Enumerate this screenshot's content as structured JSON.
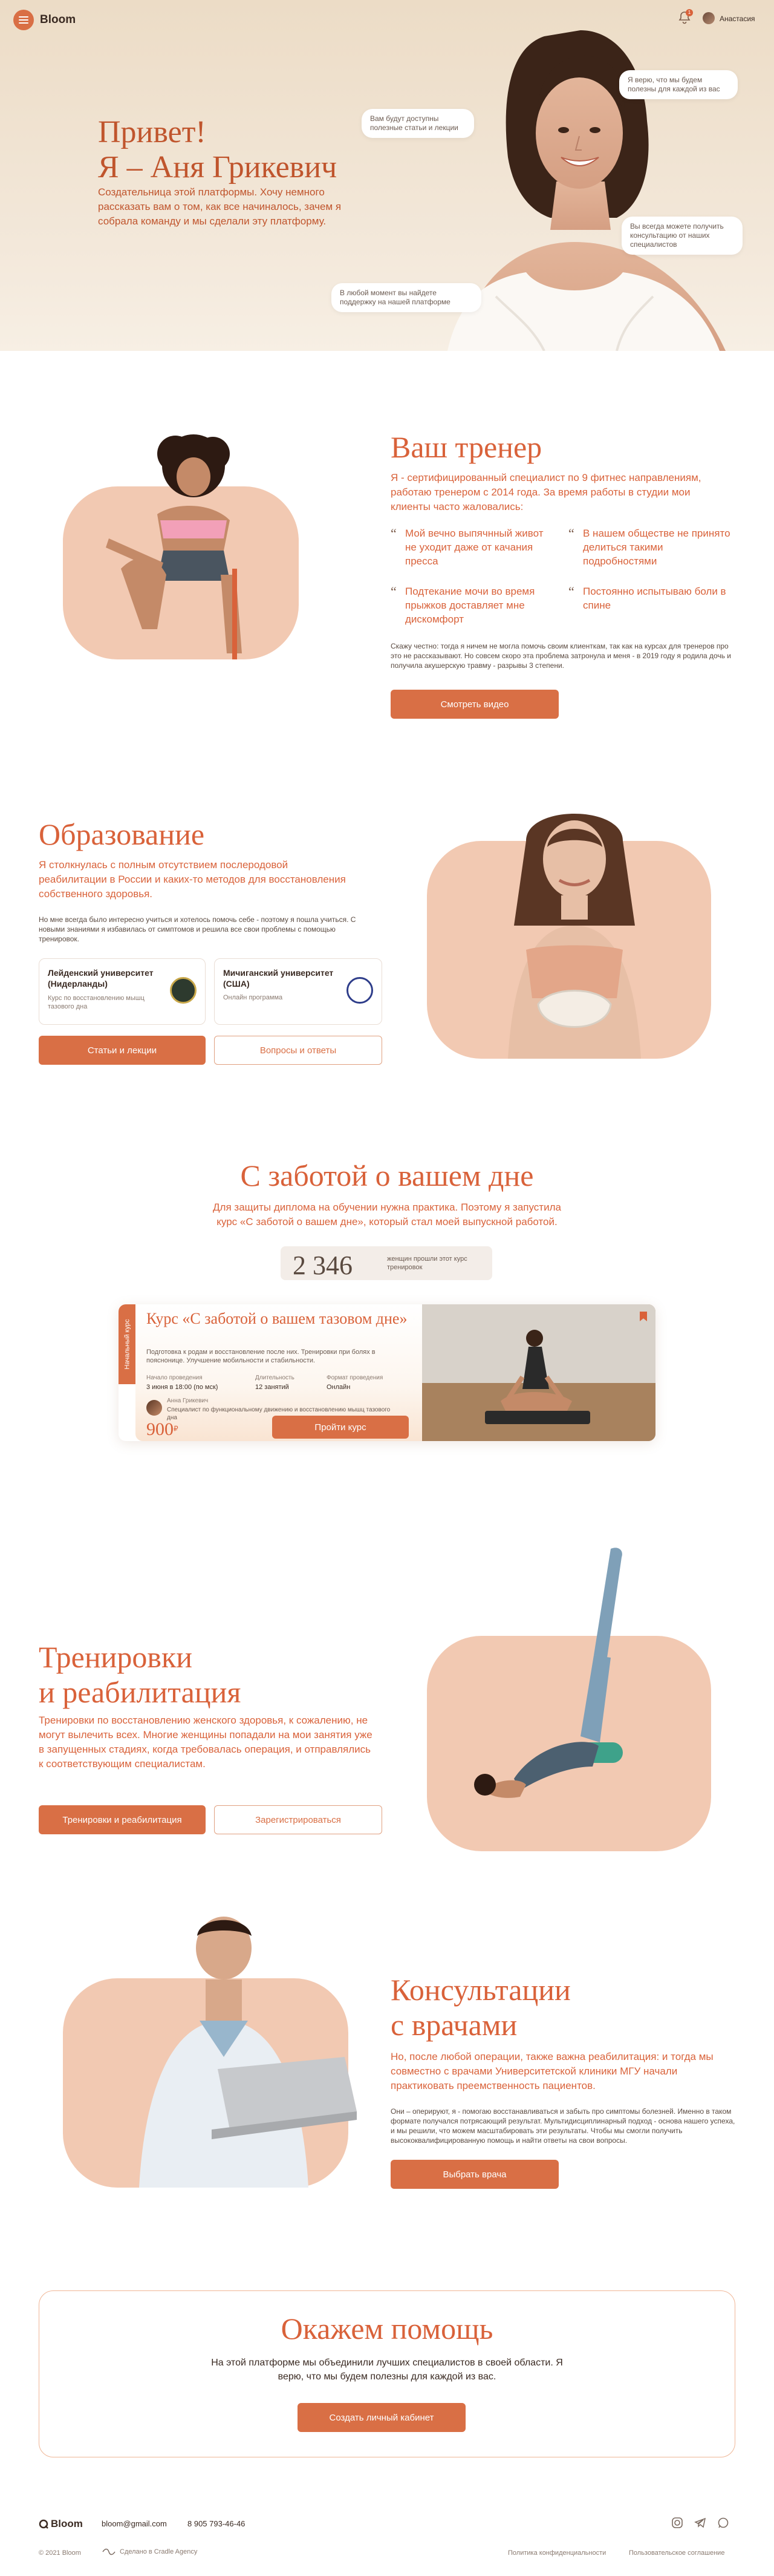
{
  "header": {
    "brand": "Bloom",
    "user_name": "Анастасия",
    "notification_count": "1"
  },
  "hero": {
    "title_line1": "Привет!",
    "title_line2": "Я – Аня Грикевич",
    "subtitle": "Создательница этой платформы. Хочу немного рассказать вам о том, как все начиналось, зачем я собрала команду и мы сделали эту платформу.",
    "bubbles": [
      "Вам будут доступны полезные статьи и лекции",
      "Я верю, что мы будем полезны для каждой из вас",
      "Вы всегда можете получить консультацию от наших специалистов",
      "В любой момент вы найдете поддержку на нашей платформе"
    ]
  },
  "trainer": {
    "title": "Ваш тренер",
    "intro": "Я - сертифицированный специалист по 9 фитнес направлениям, работаю тренером с 2014 года. За время работы в студии мои клиенты часто жаловались:",
    "quotes": [
      "Мой вечно выпячнный живот не уходит даже от качания пресса",
      "В нашем обществе не принято делиться такими подробностями",
      "Подтекание мочи во время прыжков доставляет мне дискомфорт",
      "Постоянно испытываю боли в спине"
    ],
    "note": "Скажу честно: тогда я ничем не могла помочь своим клиенткам, так как на курсах для тренеров про это не рассказывают. Но совсем скоро эта проблема затронула и меня - в 2019 году я родила дочь и получила акушерскую травму - разрывы 3 степени.",
    "button": "Смотреть видео"
  },
  "education": {
    "title": "Образование",
    "intro": "Я столкнулась с полным отсутствием послеродовой реабилитации в России и каких-то методов для восстановления собственного здоровья.",
    "note": "Но мне всегда было интересно учиться и хотелось помочь себе - поэтому я пошла учиться. С новыми знаниями я избавилась от симптомов и решила все свои проблемы с помощью тренировок.",
    "universities": [
      {
        "name": "Лейденский университет (Нидерланды)",
        "desc": "Курс по восстановлению мышц тазового дна"
      },
      {
        "name": "Мичиганский университет (США)",
        "desc": "Онлайн программа"
      }
    ],
    "btn_primary": "Статьи и лекции",
    "btn_secondary": "Вопросы и ответы"
  },
  "care": {
    "title": "С заботой о вашем дне",
    "intro": "Для защиты диплома на обучении нужна практика. Поэтому я запустила курс «С заботой о вашем дне», который стал моей выпускной работой.",
    "stat_number": "2 346",
    "stat_label": "женщин прошли этот курс тренировок",
    "course": {
      "tag": "Начальный курс",
      "title": "Курс «С заботой о вашем тазовом дне»",
      "desc": "Подготовка к родам и восстановление после них. Тренировки при болях в пояснонице. Улучшение мобильности и стабильности.",
      "meta": [
        {
          "label": "Начало проведения",
          "value": "3 июня в 18:00 (по мск)"
        },
        {
          "label": "Длительность",
          "value": "12 занятий"
        },
        {
          "label": "Формат проведения",
          "value": "Онлайн"
        }
      ],
      "author_name": "Анна Грикевич",
      "author_desc": "Специалист по функциональному движению и восстановлению мышц тазового дна",
      "price": "900",
      "currency": "₽",
      "button": "Пройти курс"
    }
  },
  "rehab": {
    "title_line1": "Тренировки",
    "title_line2": "и реабилитация",
    "intro": "Тренировки по восстановлению женского здоровья, к сожалению, не могут вылечить всех. Многие женщины попадали на мои занятия уже в запущенных стадиях, когда требовалась операция, и отправлялись к соответствующим специалистам.",
    "btn_primary": "Тренировки и реабилитация",
    "btn_secondary": "Зарегистрироваться"
  },
  "doctors": {
    "title_line1": "Консультации",
    "title_line2": "с врачами",
    "intro": "Но, после любой операции, также важна реабилитация: и тогда мы совместно с врачами Университетской клиники МГУ начали практиковать преемственность пациентов.",
    "note": "Они – оперируют, я - помогаю восстанавливаться и забыть про симптомы болезней. Именно в таком формате получался потрясающий результат. Мультидисциплинарный подход - основа нашего успеха, и мы решили, что можем масштабировать эти результаты. Чтобы мы смогли получить высококвалифицированную помощь и найти ответы на свои вопросы.",
    "button": "Выбрать врача"
  },
  "help": {
    "title": "Окажем помощь",
    "text": "На этой платформе мы объединили лучших специалистов в своей области. Я верю, что мы будем полезны для каждой из вас.",
    "button": "Создать личный кабинет"
  },
  "footer": {
    "brand": "Bloom",
    "email": "bloom@gmail.com",
    "phone": "8 905 793-46-46",
    "copyright": "© 2021 Bloom",
    "made_by": "Сделано в Cradle Agency",
    "privacy": "Политика конфиденциальности",
    "terms": "Пользовательское соглашение"
  },
  "colors": {
    "accent": "#d96f45",
    "accent_text": "#d9623a",
    "blob": "#f2c9b2",
    "hero_bg": "#ecdcc6"
  }
}
